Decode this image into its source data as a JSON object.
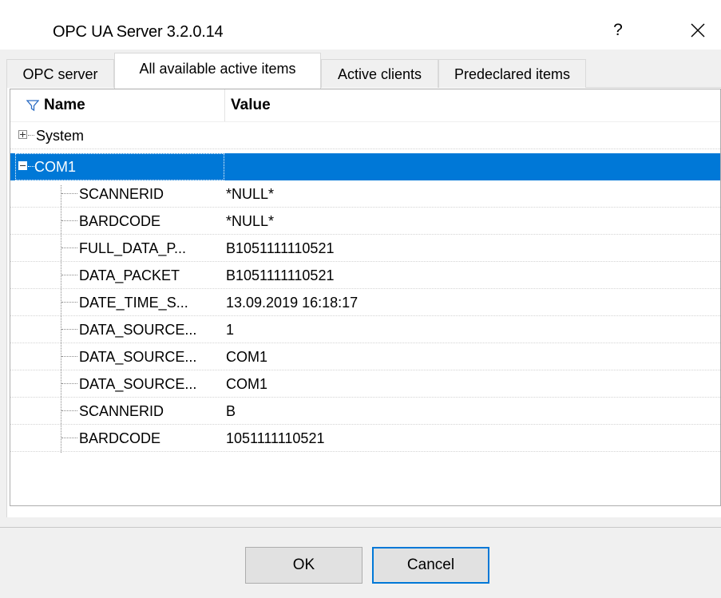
{
  "window": {
    "title": "OPC UA Server 3.2.0.14",
    "help_label": "?"
  },
  "tabs": [
    {
      "label": "OPC server",
      "active": false
    },
    {
      "label": "All available active items",
      "active": true
    },
    {
      "label": "Active clients",
      "active": false
    },
    {
      "label": "Predeclared items",
      "active": false
    }
  ],
  "grid": {
    "columns": {
      "name": "Name",
      "value": "Value"
    },
    "groups": [
      {
        "name": "System",
        "expanded": false
      },
      {
        "name": "COM1",
        "expanded": true,
        "selected": true
      }
    ],
    "rows": [
      {
        "name": "SCANNERID",
        "value": "*NULL*"
      },
      {
        "name": "BARDCODE",
        "value": "*NULL*"
      },
      {
        "name": "FULL_DATA_P...",
        "value": "B1051111110521"
      },
      {
        "name": "DATA_PACKET",
        "value": "B1051111110521"
      },
      {
        "name": "DATE_TIME_S...",
        "value": "13.09.2019 16:18:17"
      },
      {
        "name": "DATA_SOURCE...",
        "value": "1"
      },
      {
        "name": "DATA_SOURCE...",
        "value": "COM1"
      },
      {
        "name": "DATA_SOURCE...",
        "value": "COM1"
      },
      {
        "name": "SCANNERID",
        "value": "B"
      },
      {
        "name": "BARDCODE",
        "value": "1051111110521"
      }
    ]
  },
  "buttons": {
    "ok": "OK",
    "cancel": "Cancel"
  },
  "colors": {
    "selection": "#0078d7",
    "window_bg": "#f0f0f0"
  }
}
